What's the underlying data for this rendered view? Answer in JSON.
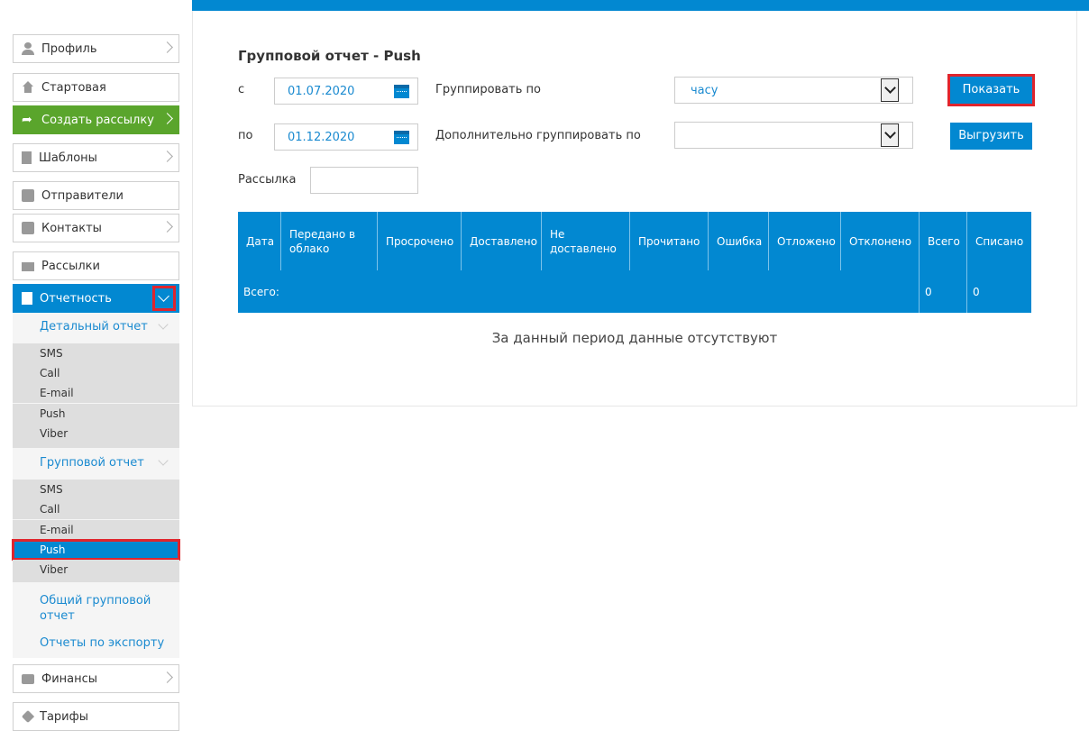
{
  "sidebar": {
    "profile": "Профиль",
    "home": "Стартовая",
    "create": "Создать рассылку",
    "templates": "Шаблоны",
    "senders": "Отправители",
    "contacts": "Контакты",
    "mailings": "Рассылки",
    "reports": "Отчетность",
    "detailed": {
      "label": "Детальный отчет",
      "items": [
        "SMS",
        "Call",
        "E-mail",
        "Push",
        "Viber"
      ]
    },
    "group": {
      "label": "Групповой отчет",
      "items": [
        "SMS",
        "Call",
        "E-mail",
        "Push",
        "Viber"
      ]
    },
    "general_group": "Общий групповой отчет",
    "export_reports": "Отчеты по экспорту",
    "finance": "Финансы",
    "tariffs": "Тарифы"
  },
  "main": {
    "title": "Групповой отчет - Push",
    "from_label": "с",
    "from_value": "01.07.2020",
    "to_label": "по",
    "to_value": "01.12.2020",
    "group_by_label": "Группировать по",
    "group_by_value": "часу",
    "extra_group_label": "Дополнительно группировать по",
    "extra_group_value": "",
    "mailing_label": "Рассылка",
    "mailing_value": "",
    "show_button": "Показать",
    "export_button": "Выгрузить"
  },
  "table": {
    "headers": {
      "date": "Дата",
      "cloud_a": "Передано в",
      "cloud_b": "облако",
      "overdue": "Просрочено",
      "delivered": "Доставлено",
      "not_delivered_a": "Не",
      "not_delivered_b": "доставлено",
      "read": "Прочитано",
      "error": "Ошибка",
      "delayed": "Отложено",
      "rejected": "Отклонено",
      "total": "Всего",
      "charged": "Списано"
    },
    "footer": {
      "label": "Всего:",
      "total": "0",
      "charged": "0"
    },
    "empty_message": "За данный период данные отсутствуют"
  },
  "colors": {
    "accent": "#0288d1",
    "green": "#5aa52c",
    "highlight": "#e0252d"
  }
}
